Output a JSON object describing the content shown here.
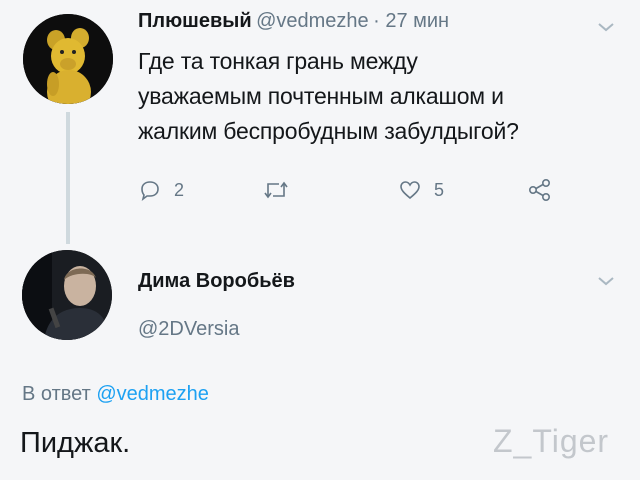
{
  "tweet": {
    "author_name": "Плюшевый",
    "author_handle": "@vedmezhe",
    "time": "· 27 мин",
    "text_lines": [
      "Где та тонкая грань между",
      "уважаемым почтенным алкашом и",
      "жалким беспробудным забулдыгой?"
    ],
    "actions": {
      "reply_count": "2",
      "retweet_count": "",
      "like_count": "5"
    }
  },
  "reply": {
    "author_name": "Дима Воробьёв",
    "author_handle": "@2DVersia",
    "reply_to_prefix": "В ответ",
    "reply_to_handle": "@vedmezhe",
    "text": "Пиджак."
  },
  "watermark": "Z_Tiger",
  "icons": [
    "chevron-down-icon",
    "reply-icon",
    "retweet-icon",
    "like-icon",
    "share-icon"
  ],
  "colors": {
    "background": "#f5f6f8",
    "link": "#1da1f2",
    "secondary_text": "#657786"
  }
}
